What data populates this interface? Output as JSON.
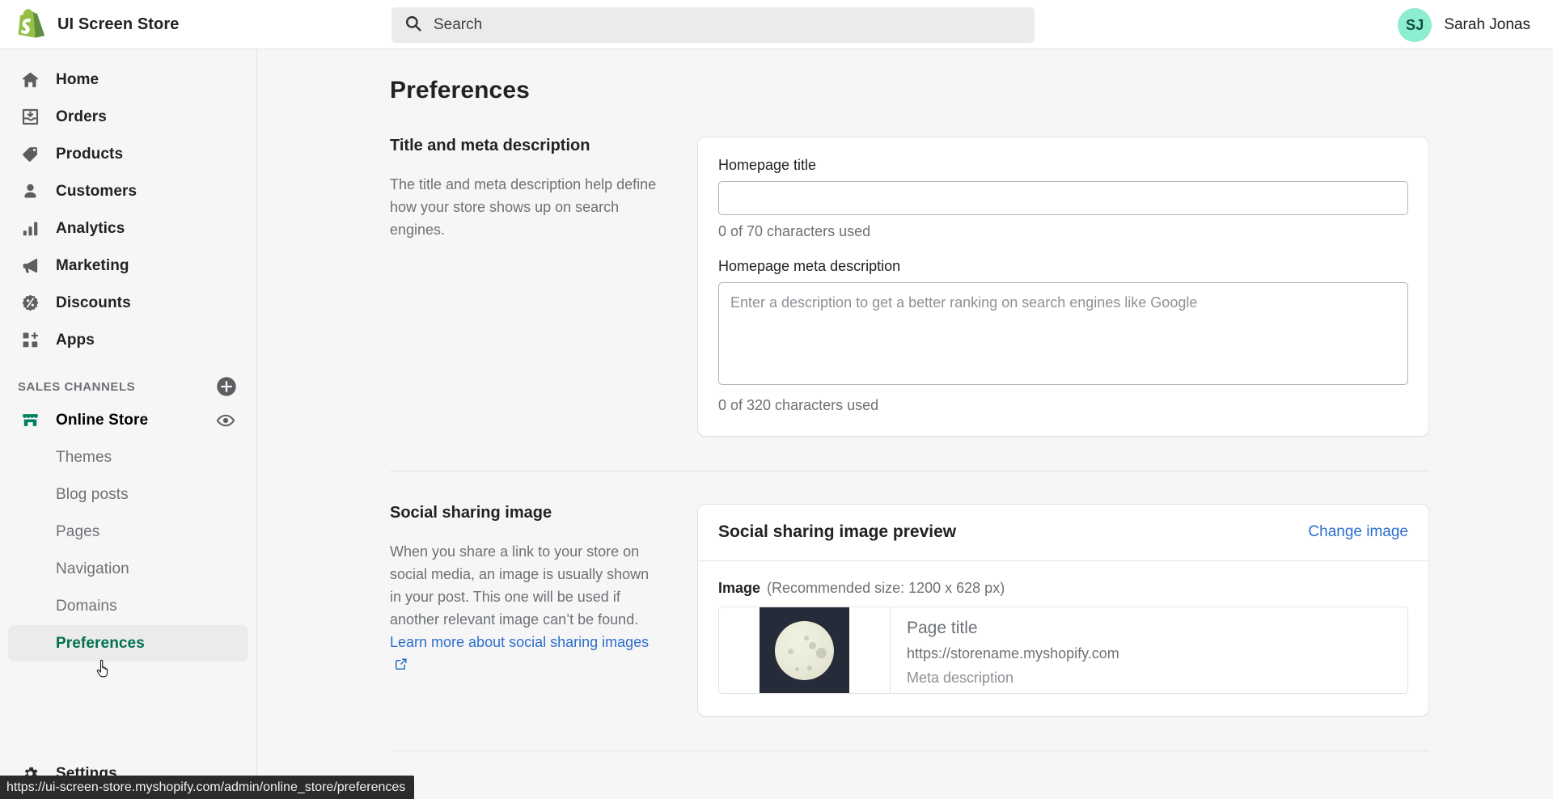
{
  "topbar": {
    "brand_name": "UI Screen Store",
    "logo_icon": "shopify-bag-logo",
    "search": {
      "icon": "search-icon",
      "placeholder": "Search"
    },
    "user": {
      "initials": "SJ",
      "name": "Sarah Jonas",
      "avatar_color": "#8cedd0"
    }
  },
  "sidebar": {
    "nav_items": [
      {
        "label": "Home",
        "icon": "home-icon"
      },
      {
        "label": "Orders",
        "icon": "orders-inbox-icon"
      },
      {
        "label": "Products",
        "icon": "products-tag-icon"
      },
      {
        "label": "Customers",
        "icon": "customers-person-icon"
      },
      {
        "label": "Analytics",
        "icon": "analytics-bars-icon"
      },
      {
        "label": "Marketing",
        "icon": "marketing-megaphone-icon"
      },
      {
        "label": "Discounts",
        "icon": "discounts-percent-icon"
      },
      {
        "label": "Apps",
        "icon": "apps-grid-plus-icon"
      }
    ],
    "sales_channels": {
      "title": "SALES CHANNELS",
      "add_icon": "plus-circle-icon",
      "channel": {
        "label": "Online Store",
        "icon": "online-store-icon",
        "icon_color": "#008060",
        "view_icon": "eye-icon"
      },
      "sub_items": [
        {
          "label": "Themes",
          "selected": false
        },
        {
          "label": "Blog posts",
          "selected": false
        },
        {
          "label": "Pages",
          "selected": false
        },
        {
          "label": "Navigation",
          "selected": false
        },
        {
          "label": "Domains",
          "selected": false
        },
        {
          "label": "Preferences",
          "selected": true
        }
      ]
    },
    "settings": {
      "label": "Settings",
      "icon": "gear-icon"
    },
    "selected_color": "#00704f"
  },
  "main": {
    "page_title": "Preferences",
    "sections": [
      {
        "heading": "Title and meta description",
        "description": "The title and meta description help define how your store shows up on search engines."
      },
      {
        "heading": "Social sharing image",
        "description_part1": "When you share a link to your store on social media, an image is usually shown in your post. This one will be used if another relevant image can’t be found. ",
        "link_text": "Learn more about social sharing images",
        "link_icon": "external-link-icon"
      }
    ],
    "seo_card": {
      "title_label": "Homepage title",
      "title_value": "",
      "title_placeholder": "",
      "title_counter": "0 of 70 characters used",
      "meta_label": "Homepage meta description",
      "meta_value": "",
      "meta_placeholder": "Enter a description to get a better ranking on search engines like Google",
      "meta_counter": "0 of 320 characters used"
    },
    "social_card": {
      "header": "Social sharing image preview",
      "change_image_label": "Change image",
      "image_label": "Image",
      "image_hint": "(Recommended size: 1200 x 628 px)",
      "thumbnail_icon": "moon-photo-thumbnail",
      "preview_title": "Page title",
      "preview_url": "https://storename.myshopify.com",
      "preview_description": "Meta description"
    }
  },
  "statusbar": {
    "url": "https://ui-screen-store.myshopify.com/admin/online_store/preferences"
  }
}
